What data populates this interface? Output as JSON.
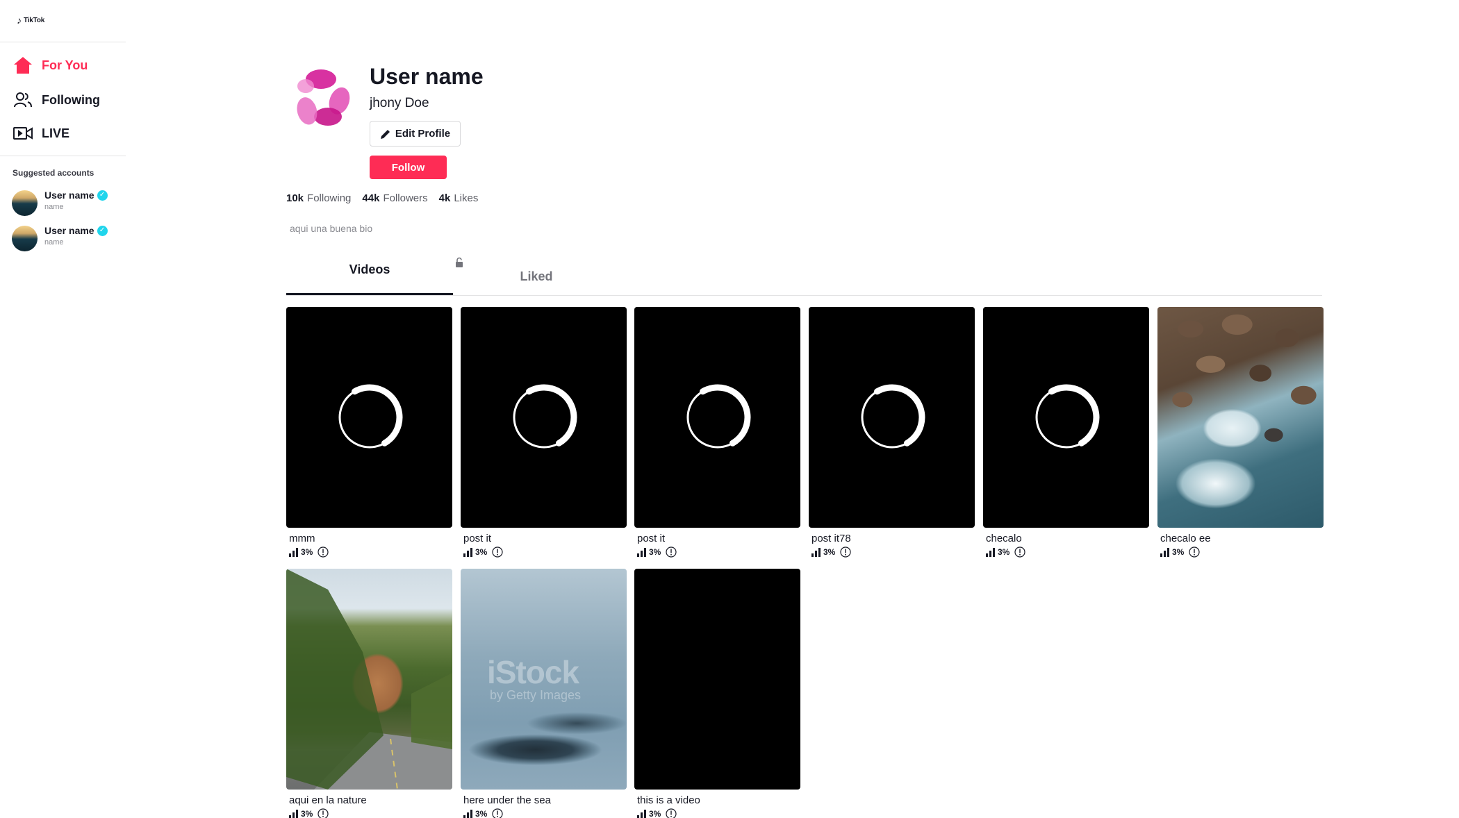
{
  "app": {
    "logo_text": "TikTok"
  },
  "sidebar": {
    "nav": [
      {
        "label": "For You",
        "icon": "home-icon"
      },
      {
        "label": "Following",
        "icon": "users-icon"
      },
      {
        "label": "LIVE",
        "icon": "live-video-icon"
      }
    ],
    "suggested_title": "Suggested accounts",
    "suggested": [
      {
        "name": "User name",
        "handle": "name"
      },
      {
        "name": "User name",
        "handle": "name"
      }
    ]
  },
  "profile": {
    "name": "User name",
    "handle": "jhony Doe",
    "edit_label": "Edit Profile",
    "follow_label": "Follow",
    "stats": [
      {
        "value": "10k",
        "label": "Following"
      },
      {
        "value": "44k",
        "label": "Followers"
      },
      {
        "value": "4k",
        "label": "Likes"
      }
    ],
    "bio": "aqui una buena bio"
  },
  "tabs": {
    "videos": "Videos",
    "liked": "Liked"
  },
  "videos": [
    {
      "caption": "mmm",
      "stat": "3%",
      "thumb": "loading"
    },
    {
      "caption": "post it",
      "stat": "3%",
      "thumb": "loading"
    },
    {
      "caption": "post it",
      "stat": "3%",
      "thumb": "loading"
    },
    {
      "caption": "post it78",
      "stat": "3%",
      "thumb": "loading"
    },
    {
      "caption": "checalo",
      "stat": "3%",
      "thumb": "loading"
    },
    {
      "caption": "checalo ee",
      "stat": "3%",
      "thumb": "rocks"
    },
    {
      "caption": "aqui en la nature",
      "stat": "3%",
      "thumb": "nature"
    },
    {
      "caption": "here under the sea",
      "stat": "3%",
      "thumb": "sky",
      "watermark": "iStock",
      "watermark_sub": "by Getty Images"
    },
    {
      "caption": "this is a video",
      "stat": "3%",
      "thumb": "black"
    }
  ],
  "colors": {
    "accent": "#fe2c55",
    "verified": "#20d5ec",
    "text": "#161823"
  }
}
